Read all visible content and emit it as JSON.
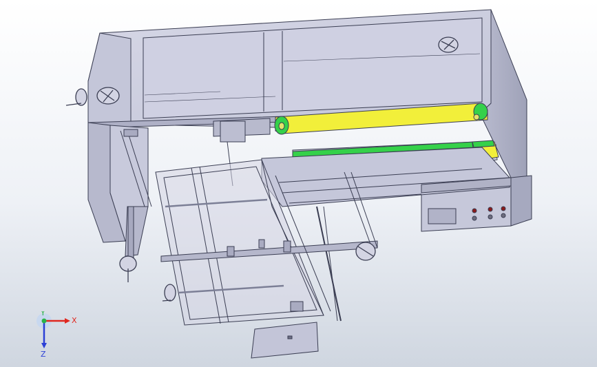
{
  "view": {
    "background_top": "#ffffff",
    "background_bottom": "#cfd6e0"
  },
  "model": {
    "body_color": "#c9cbdc",
    "edge_color": "#3a3d52",
    "belt_yellow": "#f2ef3a",
    "belt_green": "#35d14a"
  },
  "triad": {
    "x_label": "X",
    "y_label": "Y",
    "z_label": "Z",
    "x_color": "#e0271f",
    "y_color": "#2ab34a",
    "z_color": "#2b3fd6"
  }
}
